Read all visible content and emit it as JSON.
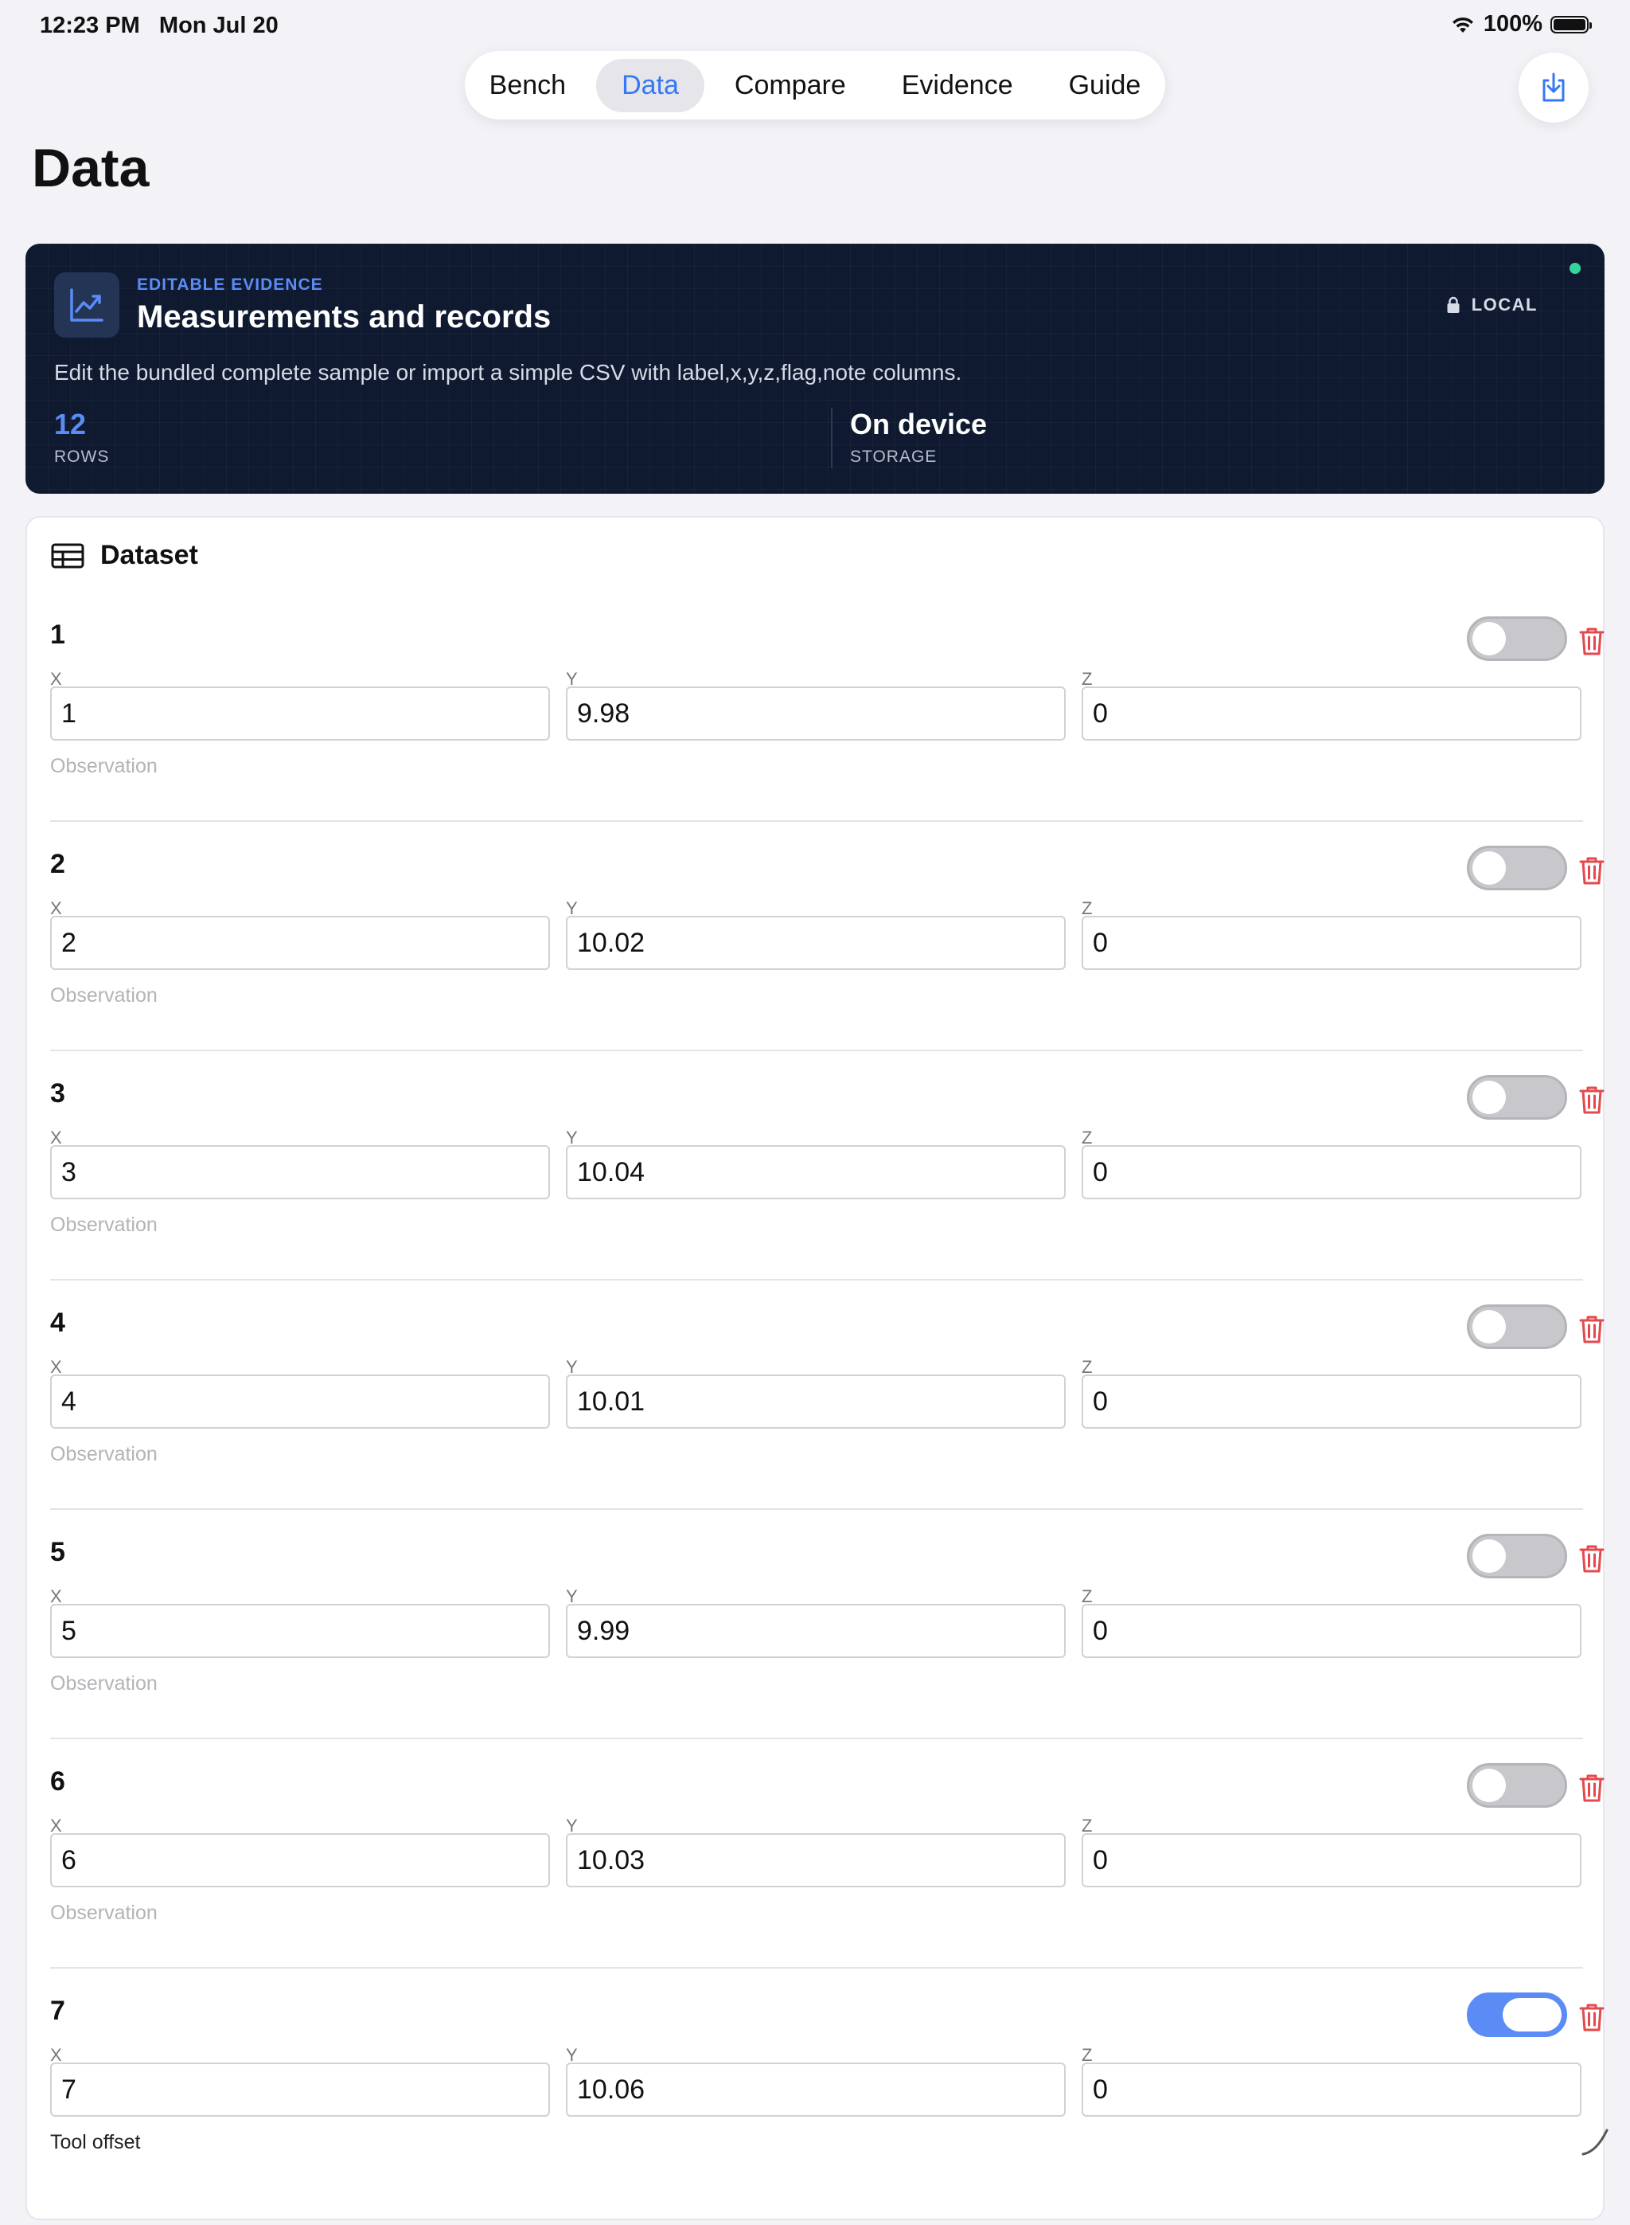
{
  "status": {
    "time": "12:23 PM",
    "date": "Mon Jul 20",
    "battery": "100%"
  },
  "tabs": [
    "Bench",
    "Data",
    "Compare",
    "Evidence",
    "Guide"
  ],
  "active_tab": "Data",
  "page_title": "Data",
  "hero": {
    "kicker": "EDITABLE EVIDENCE",
    "title": "Measurements and records",
    "description": "Edit the bundled complete sample or import a simple CSV with label,x,y,z,flag,note columns.",
    "badge": "LOCAL",
    "stats": [
      {
        "value": "12",
        "label": "ROWS"
      },
      {
        "value": "On device",
        "label": "STORAGE"
      }
    ]
  },
  "dataset": {
    "title": "Dataset",
    "field_labels": {
      "x": "X",
      "y": "Y",
      "z": "Z"
    },
    "rows": [
      {
        "label": "1",
        "x": "1",
        "y": "9.98",
        "z": "0",
        "note": "Observation",
        "flag": false
      },
      {
        "label": "2",
        "x": "2",
        "y": "10.02",
        "z": "0",
        "note": "Observation",
        "flag": false
      },
      {
        "label": "3",
        "x": "3",
        "y": "10.04",
        "z": "0",
        "note": "Observation",
        "flag": false
      },
      {
        "label": "4",
        "x": "4",
        "y": "10.01",
        "z": "0",
        "note": "Observation",
        "flag": false
      },
      {
        "label": "5",
        "x": "5",
        "y": "9.99",
        "z": "0",
        "note": "Observation",
        "flag": false
      },
      {
        "label": "6",
        "x": "6",
        "y": "10.03",
        "z": "0",
        "note": "Observation",
        "flag": false
      },
      {
        "label": "7",
        "x": "7",
        "y": "10.06",
        "z": "0",
        "note": "Tool offset",
        "flag": true
      }
    ]
  },
  "colors": {
    "accent": "#3478f6",
    "hero_bg": "#0f1a30",
    "danger": "#e5484d",
    "live": "#34d399"
  }
}
